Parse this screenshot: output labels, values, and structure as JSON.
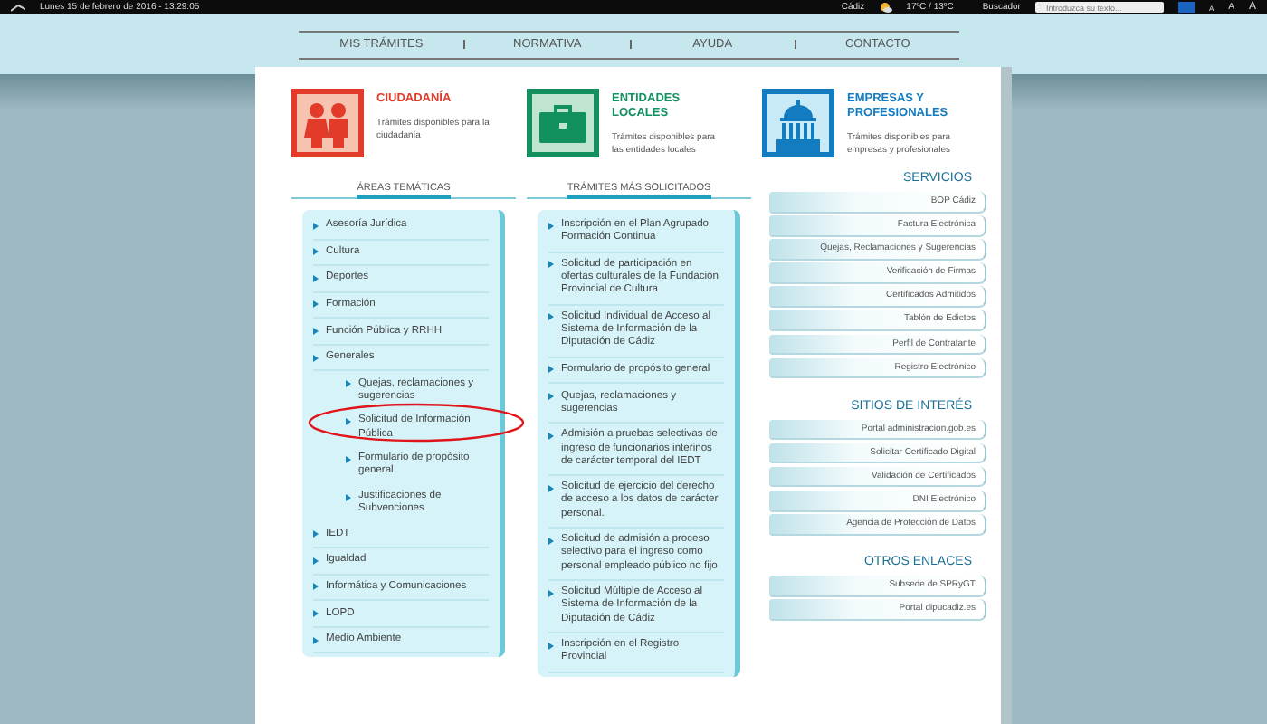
{
  "top_bar": {
    "date": "Lunes 15 de febrero de 2016 - 13:29:05",
    "city": "Cádiz",
    "weather": "17ºC / 13ºC",
    "search_label": "Buscador",
    "search_placeholder": "Introduzca su texto...",
    "font_sizes": [
      "A",
      "A",
      "A"
    ]
  },
  "nav": [
    {
      "label": "MIS TRÁMITES"
    },
    {
      "label": "NORMATIVA"
    },
    {
      "label": "AYUDA"
    },
    {
      "label": "CONTACTO"
    }
  ],
  "categories": [
    {
      "kind": "people",
      "title": "CIUDADANÍA",
      "color": "#e23b2a",
      "description": "Trámites disponibles para la ciudadanía"
    },
    {
      "kind": "briefcase",
      "title": "ENTIDADES LOCALES",
      "color": "#12915f",
      "description": "Trámites disponibles para las entidades locales"
    },
    {
      "kind": "building",
      "title": "EMPRESAS Y PROFESIONALES",
      "color": "#137cc0",
      "description": "Trámites disponibles para empresas y profesionales"
    }
  ],
  "areas": {
    "heading": "ÁREAS TEMÁTICAS",
    "items": [
      {
        "label": "Asesoría Jurídica"
      },
      {
        "label": "Cultura"
      },
      {
        "label": "Deportes"
      },
      {
        "label": "Formación"
      },
      {
        "label": "Función Pública y RRHH"
      },
      {
        "label": "Generales",
        "children": [
          {
            "label": "Quejas, reclamaciones y sugerencias",
            "highlighted": false
          },
          {
            "label": "Solicitud de Información Pública",
            "highlighted": true
          },
          {
            "label": "Formulario de propósito general",
            "highlighted": false
          },
          {
            "label": "Justificaciones de Subvenciones",
            "highlighted": false
          }
        ]
      },
      {
        "label": "IEDT"
      },
      {
        "label": "Igualdad"
      },
      {
        "label": "Informática y Comunicaciones"
      },
      {
        "label": "LOPD"
      },
      {
        "label": "Medio Ambiente"
      }
    ]
  },
  "tramites": {
    "heading": "TRÁMITES MÁS SOLICITADOS",
    "items": [
      "Inscripción en el Plan Agrupado Formación Continua",
      "Solicitud de participación en ofertas culturales de la Fundación Provincial de Cultura",
      "Solicitud Individual de Acceso al Sistema de Información de la Diputación de Cádiz",
      "Formulario de propósito general",
      "Quejas, reclamaciones y sugerencias",
      "Admisión a pruebas selectivas de ingreso de funcionarios interinos de carácter temporal del IEDT",
      "Solicitud de ejercicio del derecho de acceso a los datos de carácter personal.",
      "Solicitud de admisión a proceso selectivo para el ingreso como personal empleado público no fijo",
      "Solicitud Múltiple de Acceso al Sistema de Información de la Diputación de Cádiz",
      "Inscripción en el Registro Provincial"
    ]
  },
  "sidebar": [
    {
      "heading": "SERVICIOS",
      "links": [
        "BOP Cádiz",
        "Factura Electrónica",
        "Quejas, Reclamaciones y Sugerencias",
        "Verificación de Firmas",
        "Certificados Admitidos",
        "Tablón de Edictos",
        "Perfil de Contratante",
        "Registro Electrónico"
      ]
    },
    {
      "heading": "SITIOS DE INTERÉS",
      "links": [
        "Portal administracion.gob.es",
        "Solicitar Certificado Digital",
        "Validación de Certificados",
        "DNI Electrónico",
        "Agencia de Protección de Datos"
      ]
    },
    {
      "heading": "OTROS ENLACES",
      "links": [
        "Subsede de SPRyGT",
        "Portal dipucadiz.es"
      ]
    }
  ]
}
